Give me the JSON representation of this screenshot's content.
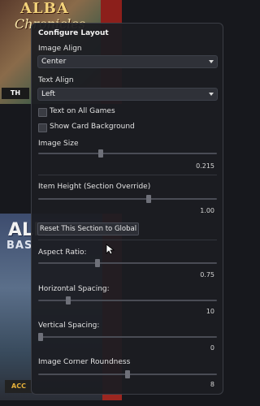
{
  "background": {
    "cover_top": {
      "title_line1": "ALBA",
      "title_line2": "Chronicles",
      "logo": "TH"
    },
    "cover_mid": {
      "title_line1": "ALL",
      "title_line2": "BAS",
      "logo": "ACC"
    }
  },
  "panel": {
    "title": "Configure Layout",
    "image_align": {
      "label": "Image Align",
      "value": "Center"
    },
    "text_align": {
      "label": "Text Align",
      "value": "Left"
    },
    "text_on_all_games": {
      "label": "Text on All Games",
      "checked": false
    },
    "show_card_background": {
      "label": "Show Card Background",
      "checked": false
    },
    "image_size": {
      "label": "Image Size",
      "value": "0.215",
      "level": 0.35
    },
    "item_height": {
      "label": "Item Height (Section Override)",
      "value": "1.00",
      "level": 0.62
    },
    "reset_button": {
      "label": "Reset This Section to Global"
    },
    "aspect_ratio": {
      "label": "Aspect Ratio:",
      "value": "0.75",
      "level": 0.33
    },
    "horizontal_spacing": {
      "label": "Horizontal Spacing:",
      "value": "10",
      "level": 0.17
    },
    "vertical_spacing": {
      "label": "Vertical Spacing:",
      "value": "0",
      "level": 0.0
    },
    "image_corner_roundness": {
      "label": "Image Corner Roundness",
      "value": "8",
      "level": 0.5
    }
  },
  "colors": {
    "background": "#17181d",
    "panel": "#1c1d22",
    "panel_border": "#3b3d45",
    "dropdown": "#2f3138",
    "slider_track": "#4a4c55",
    "slider_thumb": "#6e7079"
  }
}
